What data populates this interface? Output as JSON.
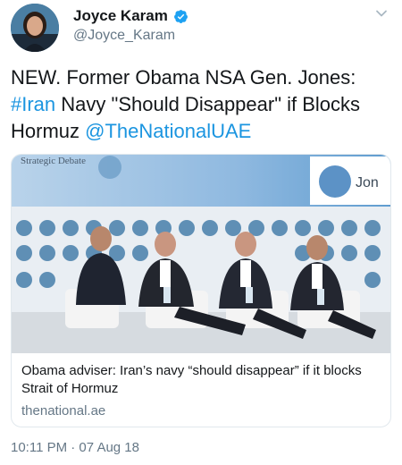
{
  "author": {
    "display_name": "Joyce Karam",
    "handle": "@Joyce_Karam",
    "verified": true
  },
  "tweet": {
    "line_prefix": "NEW. Former Obama NSA Gen. Jones: ",
    "hashtag": "#Iran",
    "middle": " Navy \"Should Disappear\" if Blocks Hormuz ",
    "mention": "@TheNationalUAE"
  },
  "card": {
    "image_banner_text": "Strategic Debate",
    "image_nameplate_text": "Jon",
    "title": "Obama adviser: Iran’s navy “should disappear” if it blocks Strait of Hormuz",
    "domain": "thenational.ae"
  },
  "timestamp": "10:11 PM · 07 Aug 18",
  "colors": {
    "link": "#1b95e0",
    "secondary_text": "#657786",
    "verified_badge": "#1da1f2",
    "card_border": "#e1e8ed"
  },
  "icons": {
    "verified": "verified-badge-icon",
    "menu": "chevron-down-icon"
  }
}
